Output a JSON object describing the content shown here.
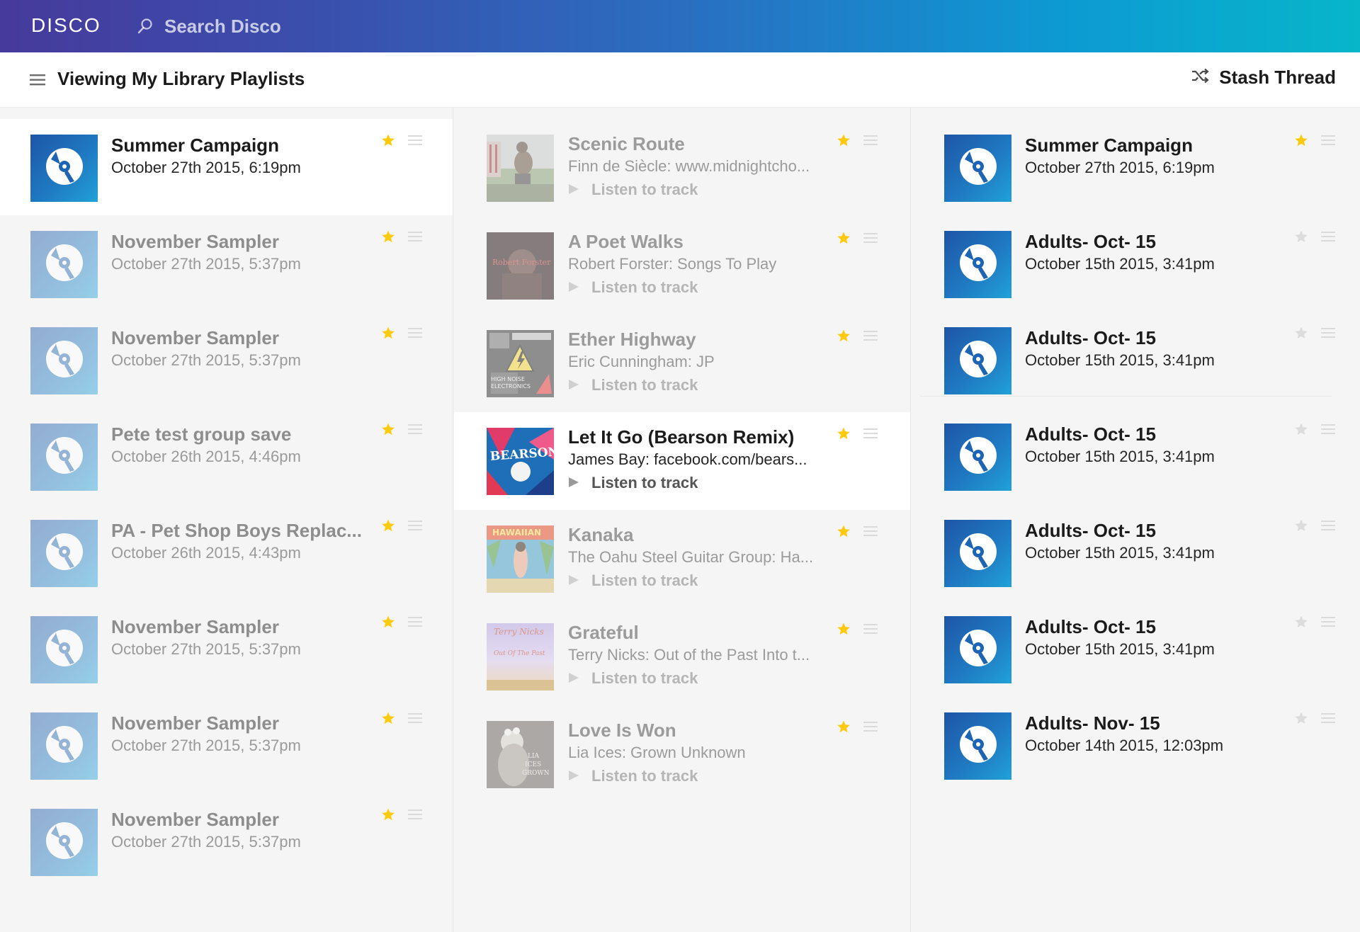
{
  "app": {
    "logo": "DISCO",
    "search_placeholder": "Search Disco",
    "accent_gradient": [
      "#463a9c",
      "#2a6ec0",
      "#07b6c9"
    ],
    "star_color": "#ffc90e"
  },
  "header": {
    "view_title": "Viewing My Library Playlists",
    "stash_label": "Stash Thread"
  },
  "playlists_left": [
    {
      "title": "Summer Campaign",
      "date": "October 27th 2015, 6:19pm",
      "starred": true,
      "active": true
    },
    {
      "title": "November Sampler",
      "date": "October 27th 2015, 5:37pm",
      "starred": true,
      "active": false
    },
    {
      "title": "November Sampler",
      "date": "October 27th 2015, 5:37pm",
      "starred": true,
      "active": false
    },
    {
      "title": "Pete test group save",
      "date": "October 26th 2015, 4:46pm",
      "starred": true,
      "active": false
    },
    {
      "title": "PA - Pet Shop Boys Replac...",
      "date": "October 26th 2015, 4:43pm",
      "starred": true,
      "active": false
    },
    {
      "title": "November Sampler",
      "date": "October 27th 2015, 5:37pm",
      "starred": true,
      "active": false
    },
    {
      "title": "November Sampler",
      "date": "October 27th 2015, 5:37pm",
      "starred": true,
      "active": false
    },
    {
      "title": "November Sampler",
      "date": "October 27th 2015, 5:37pm",
      "starred": true,
      "active": false
    }
  ],
  "tracks": [
    {
      "title": "Scenic Route",
      "subtitle": "Finn de Siècle: www.midnightcho...",
      "listen": "Listen to track",
      "starred": true,
      "active": false,
      "art": "scenic"
    },
    {
      "title": "A Poet Walks",
      "subtitle": "Robert Forster: Songs To Play",
      "listen": "Listen to track",
      "starred": true,
      "active": false,
      "art": "poet"
    },
    {
      "title": "Ether Highway",
      "subtitle": "Eric Cunningham: JP",
      "listen": "Listen to track",
      "starred": true,
      "active": false,
      "art": "ether"
    },
    {
      "title": "Let It Go (Bearson Remix)",
      "subtitle": "James Bay: facebook.com/bears...",
      "listen": "Listen to track",
      "starred": true,
      "active": true,
      "art": "bearson"
    },
    {
      "title": "Kanaka",
      "subtitle": "The Oahu Steel Guitar Group: Ha...",
      "listen": "Listen to track",
      "starred": true,
      "active": false,
      "art": "kanaka"
    },
    {
      "title": "Grateful",
      "subtitle": "Terry Nicks: Out of the Past Into t...",
      "listen": "Listen to track",
      "starred": true,
      "active": false,
      "art": "grateful"
    },
    {
      "title": "Love Is Won",
      "subtitle": "Lia Ices: Grown Unknown",
      "listen": "Listen to track",
      "starred": true,
      "active": false,
      "art": "love"
    }
  ],
  "playlists_right": [
    {
      "title": "Summer Campaign",
      "date": "October 27th 2015, 6:19pm",
      "starred": true
    },
    {
      "title": "Adults- Oct- 15",
      "date": "October 15th 2015, 3:41pm",
      "starred": false
    },
    {
      "title": "Adults- Oct- 15",
      "date": "October 15th 2015, 3:41pm",
      "starred": false
    },
    {
      "title": "Adults- Oct- 15",
      "date": "October 15th 2015, 3:41pm",
      "starred": false
    },
    {
      "title": "Adults- Oct- 15",
      "date": "October 15th 2015, 3:41pm",
      "starred": false
    },
    {
      "title": "Adults- Oct- 15",
      "date": "October 15th 2015, 3:41pm",
      "starred": false
    },
    {
      "title": "Adults- Nov- 15",
      "date": "October 14th 2015, 12:03pm",
      "starred": false
    }
  ]
}
